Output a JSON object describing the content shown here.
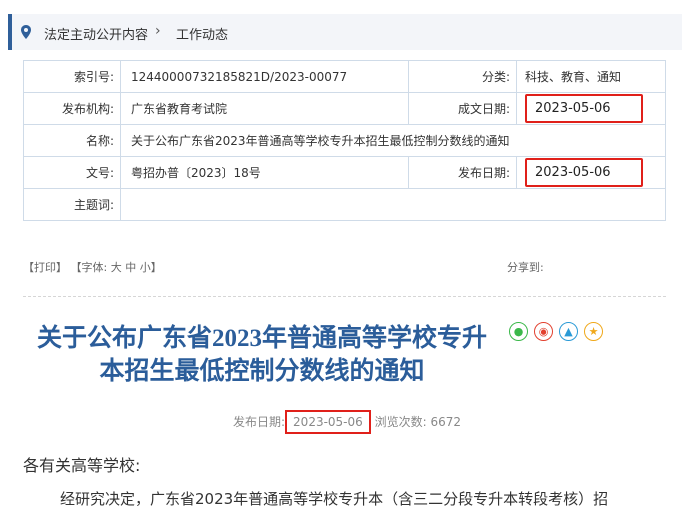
{
  "breadcrumb": {
    "section": "法定主动公开内容",
    "current": "工作动态"
  },
  "meta": {
    "index_label": "索引号:",
    "index_value": "12440000732185821D/2023-00077",
    "category_label": "分类:",
    "category_value": "科技、教育、通知",
    "publisher_label": "发布机构:",
    "publisher_value": "广东省教育考试院",
    "created_label": "成文日期:",
    "created_value": "2023-05-06",
    "name_label": "名称:",
    "name_value": "关于公布广东省2023年普通高等学校专升本招生最低控制分数线的通知",
    "docno_label": "文号:",
    "docno_value": "粤招办普〔2023〕18号",
    "pubdate_label": "发布日期:",
    "pubdate_value": "2023-05-06",
    "subject_label": "主题词:",
    "subject_value": ""
  },
  "tools": {
    "print": "【打印】",
    "font_label": "【字体:",
    "font_large": "大",
    "font_medium": "中",
    "font_small": "小】",
    "share_label": "分享到:"
  },
  "article": {
    "title_line1": "关于公布广东省2023年普通高等学校专升",
    "title_line2": "本招生最低控制分数线的通知",
    "date_label": "发布日期:",
    "date_value": "2023-05-06",
    "views_label": "浏览次数:",
    "views_value": "6672",
    "greeting": "各有关高等学校:",
    "body_start": "经研究决定，广东省2023年普通高等学校专升本（含三二分段专升本转段考核）招"
  },
  "colors": {
    "accent": "#2b5d9a",
    "highlight": "#e0201a",
    "border": "#cfdbe8"
  }
}
